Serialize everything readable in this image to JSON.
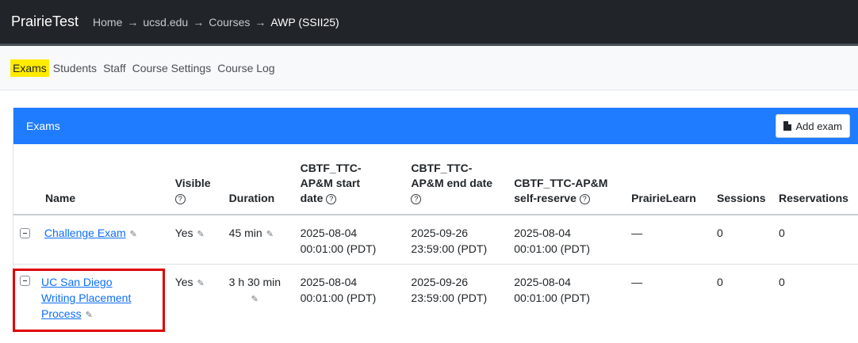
{
  "app": {
    "brand": "PrairieTest"
  },
  "breadcrumb": [
    "Home",
    "ucsd.edu",
    "Courses",
    "AWP (SSII25)"
  ],
  "breadcrumb_sep": "→",
  "tabs": [
    "Exams",
    "Students",
    "Staff",
    "Course Settings",
    "Course Log"
  ],
  "card": {
    "title": "Exams",
    "add_button": "Add exam"
  },
  "help_glyph": "?",
  "edit_glyph": "✎",
  "table": {
    "headers": {
      "name": "Name",
      "visible": "Visible",
      "duration": "Duration",
      "start": [
        "CBTF_TTC-",
        "AP&M start",
        "date"
      ],
      "end": [
        "CBTF_TTC-",
        "AP&M end date"
      ],
      "reserve": [
        "CBTF_TTC-AP&M",
        "self-reserve"
      ],
      "prairielearn": "PrairieLearn",
      "sessions": "Sessions",
      "reservations": "Reservations"
    },
    "rows": [
      {
        "name": "Challenge Exam",
        "visible": "Yes",
        "duration": "45 min",
        "start": [
          "2025-08-04",
          "00:01:00 (PDT)"
        ],
        "end": [
          "2025-09-26",
          "23:59:00 (PDT)"
        ],
        "reserve": [
          "2025-08-04",
          "00:01:00 (PDT)"
        ],
        "prairielearn": "—",
        "sessions": "0",
        "reservations": "0"
      },
      {
        "name_lines": [
          "UC San Diego",
          "Writing Placement",
          "Process"
        ],
        "visible": "Yes",
        "duration": "3 h 30 min",
        "start": [
          "2025-08-04",
          "00:01:00 (PDT)"
        ],
        "end": [
          "2025-09-26",
          "23:59:00 (PDT)"
        ],
        "reserve": [
          "2025-08-04",
          "00:01:00 (PDT)"
        ],
        "prairielearn": "—",
        "sessions": "0",
        "reservations": "0"
      }
    ]
  }
}
